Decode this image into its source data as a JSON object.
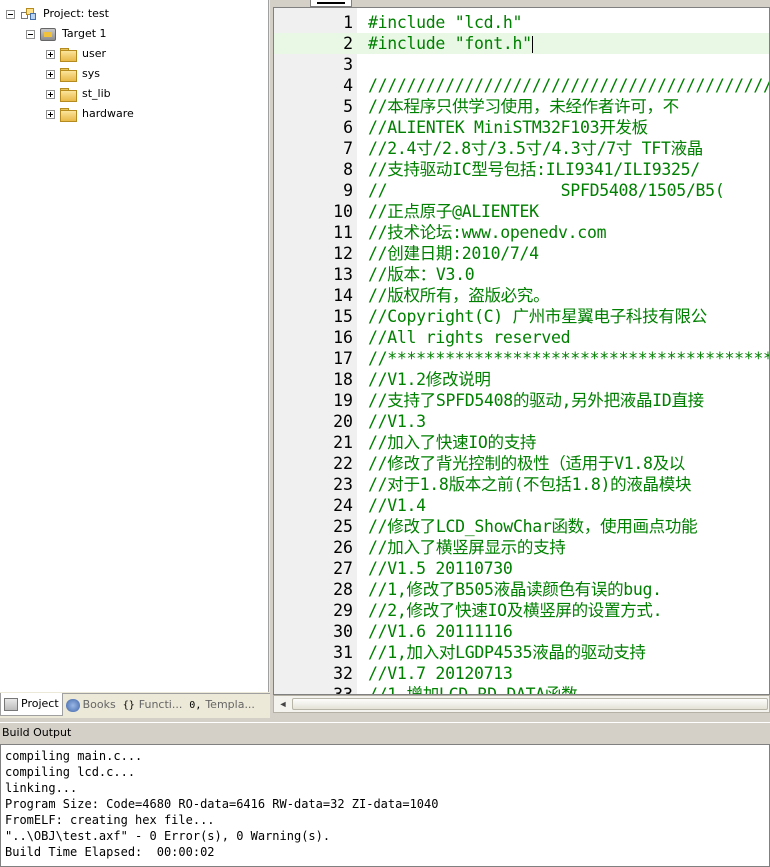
{
  "project_tree": {
    "project_label": "Project: test",
    "target_label": "Target 1",
    "groups": [
      "user",
      "sys",
      "st_lib",
      "hardware"
    ]
  },
  "project_tabs": [
    {
      "label": "Project",
      "icon": "project-icon",
      "active": true
    },
    {
      "label": "Books",
      "icon": "books-icon",
      "active": false
    },
    {
      "label": "Functi...",
      "icon": "functions-icon",
      "active": false
    },
    {
      "label": "Templa...",
      "icon": "templates-icon",
      "active": false
    }
  ],
  "editor": {
    "lines": [
      {
        "n": "1",
        "text": "#include \"lcd.h\""
      },
      {
        "n": "2",
        "text": "#include \"font.h\""
      },
      {
        "n": "3",
        "text": ""
      },
      {
        "n": "4",
        "text": "//////////////////////////////////////////"
      },
      {
        "n": "5",
        "text": "//本程序只供学习使用，未经作者许可，不"
      },
      {
        "n": "6",
        "text": "//ALIENTEK MiniSTM32F103开发板"
      },
      {
        "n": "7",
        "text": "//2.4寸/2.8寸/3.5寸/4.3寸/7寸 TFT液晶"
      },
      {
        "n": "8",
        "text": "//支持驱动IC型号包括:ILI9341/ILI9325/"
      },
      {
        "n": "9",
        "text": "//                  SPFD5408/1505/B5("
      },
      {
        "n": "10",
        "text": "//正点原子@ALIENTEK"
      },
      {
        "n": "11",
        "text": "//技术论坛:www.openedv.com"
      },
      {
        "n": "12",
        "text": "//创建日期:2010/7/4"
      },
      {
        "n": "13",
        "text": "//版本：V3.0"
      },
      {
        "n": "14",
        "text": "//版权所有，盗版必究。"
      },
      {
        "n": "15",
        "text": "//Copyright(C) 广州市星翼电子科技有限公"
      },
      {
        "n": "16",
        "text": "//All rights reserved"
      },
      {
        "n": "17",
        "text": "//*****************************************"
      },
      {
        "n": "18",
        "text": "//V1.2修改说明"
      },
      {
        "n": "19",
        "text": "//支持了SPFD5408的驱动,另外把液晶ID直接"
      },
      {
        "n": "20",
        "text": "//V1.3"
      },
      {
        "n": "21",
        "text": "//加入了快速IO的支持"
      },
      {
        "n": "22",
        "text": "//修改了背光控制的极性（适用于V1.8及以"
      },
      {
        "n": "23",
        "text": "//对于1.8版本之前(不包括1.8)的液晶模块"
      },
      {
        "n": "24",
        "text": "//V1.4"
      },
      {
        "n": "25",
        "text": "//修改了LCD_ShowChar函数，使用画点功能"
      },
      {
        "n": "26",
        "text": "//加入了横竖屏显示的支持"
      },
      {
        "n": "27",
        "text": "//V1.5 20110730"
      },
      {
        "n": "28",
        "text": "//1,修改了B505液晶读颜色有误的bug."
      },
      {
        "n": "29",
        "text": "//2,修改了快速IO及横竖屏的设置方式."
      },
      {
        "n": "30",
        "text": "//V1.6 20111116"
      },
      {
        "n": "31",
        "text": "//1,加入对LGDP4535液晶的驱动支持"
      },
      {
        "n": "32",
        "text": "//V1.7 20120713"
      },
      {
        "n": "33",
        "text": "//1,增加LCD_RD_DATA函数"
      }
    ]
  },
  "build_output": {
    "title": "Build Output",
    "lines": [
      "compiling main.c...",
      "compiling lcd.c...",
      "linking...",
      "Program Size: Code=4680 RO-data=6416 RW-data=32 ZI-data=1040",
      "FromELF: creating hex file...",
      "\"..\\OBJ\\test.axf\" - 0 Error(s), 0 Warning(s).",
      "Build Time Elapsed:  00:00:02"
    ]
  }
}
